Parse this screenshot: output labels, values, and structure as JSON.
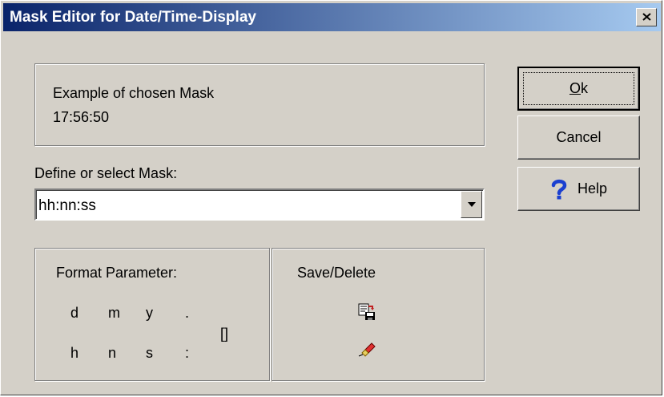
{
  "window": {
    "title": "Mask Editor for Date/Time-Display",
    "close_icon": "close-icon"
  },
  "example": {
    "label": "Example of chosen Mask",
    "value": "17:56:50"
  },
  "mask": {
    "label": "Define or select Mask:",
    "value": "hh:nn:ss"
  },
  "format": {
    "title": "Format Parameter:",
    "row1": [
      "d",
      "m",
      "y",
      "."
    ],
    "row2": [
      "h",
      "n",
      "s",
      ":"
    ],
    "brackets": "[]"
  },
  "save_delete": {
    "title": "Save/Delete",
    "save_icon": "save-mask-icon",
    "delete_icon": "delete-mask-icon"
  },
  "buttons": {
    "ok": "Ok",
    "ok_mnemonic": "O",
    "cancel": "Cancel",
    "help": "Help",
    "help_icon": "help-question-icon"
  },
  "colors": {
    "titlebar_start": "#0a246a",
    "titlebar_end": "#a6caf0",
    "dialog_bg": "#d4d0c8",
    "help_icon": "#1a3fd0"
  }
}
